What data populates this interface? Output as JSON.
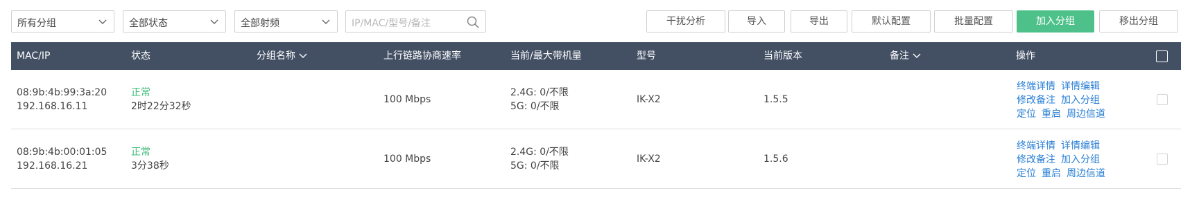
{
  "filters": {
    "group": "所有分组",
    "status": "全部状态",
    "band": "全部射频",
    "search_placeholder": "IP/MAC/型号/备注"
  },
  "actions": {
    "interference": "干扰分析",
    "import": "导入",
    "export": "导出",
    "default_config": "默认配置",
    "batch_config": "批量配置",
    "join_group": "加入分组",
    "leave_group": "移出分组"
  },
  "colors": {
    "header_bg": "#435064",
    "primary": "#4ec18a",
    "link": "#2a7fd4",
    "ok": "#3dbb78"
  },
  "table": {
    "headers": {
      "mac_ip": "MAC/IP",
      "status": "状态",
      "group": "分组名称",
      "uplink": "上行链路协商速率",
      "load": "当前/最大带机量",
      "model": "型号",
      "version": "当前版本",
      "note": "备注",
      "ops": "操作"
    },
    "rows": [
      {
        "mac": "08:9b:4b:99:3a:20",
        "ip": "192.168.16.11",
        "status": "正常",
        "uptime": "2时22分32秒",
        "group": "",
        "uplink": "100 Mbps",
        "load_24": "2.4G: 0/不限",
        "load_5": "5G: 0/不限",
        "model": "IK-X2",
        "version": "1.5.5",
        "note": ""
      },
      {
        "mac": "08:9b:4b:00:01:05",
        "ip": "192.168.16.21",
        "status": "正常",
        "uptime": "3分38秒",
        "group": "",
        "uplink": "100 Mbps",
        "load_24": "2.4G: 0/不限",
        "load_5": "5G: 0/不限",
        "model": "IK-X2",
        "version": "1.5.6",
        "note": ""
      }
    ],
    "ops_links": {
      "terminal_detail": "终端详情",
      "edit_detail": "详情编辑",
      "edit_note": "修改备注",
      "join_group": "加入分组",
      "locate": "定位",
      "reboot": "重启",
      "nearby_channel": "周边信道"
    }
  }
}
